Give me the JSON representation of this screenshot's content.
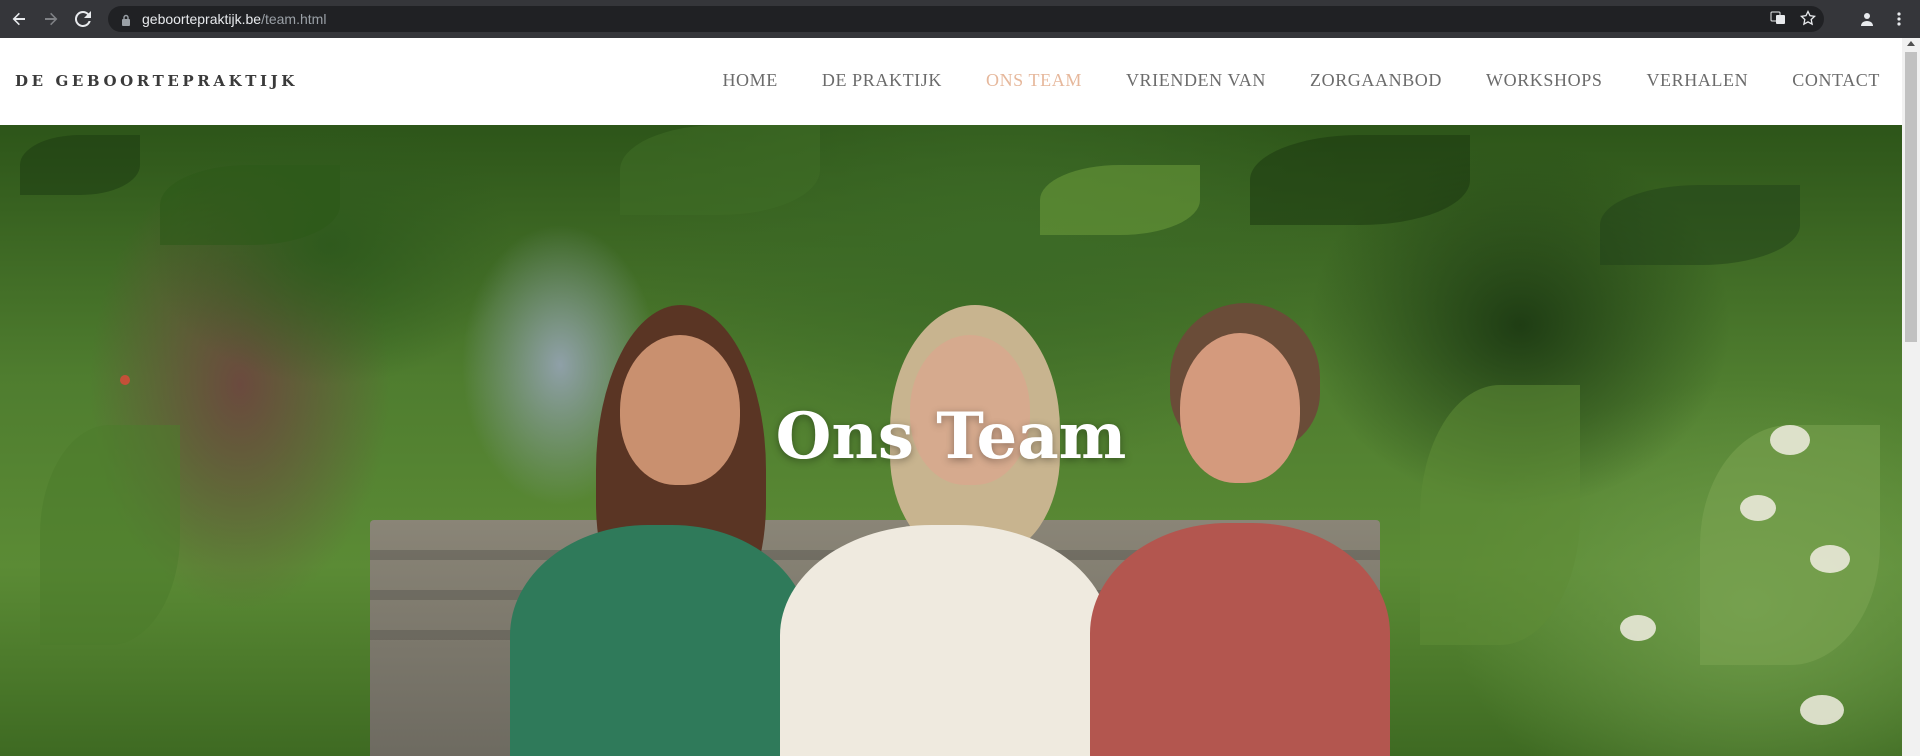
{
  "browser": {
    "url_domain": "geboortepraktijk.be",
    "url_path": "/team.html"
  },
  "site": {
    "logo": "DE GEBOORTEPRAKTIJK",
    "nav": [
      {
        "label": "HOME",
        "active": false
      },
      {
        "label": "DE PRAKTIJK",
        "active": false
      },
      {
        "label": "ONS TEAM",
        "active": true
      },
      {
        "label": "VRIENDEN VAN",
        "active": false
      },
      {
        "label": "ZORGAANBOD",
        "active": false
      },
      {
        "label": "WORKSHOPS",
        "active": false
      },
      {
        "label": "VERHALEN",
        "active": false
      },
      {
        "label": "CONTACT",
        "active": false
      }
    ],
    "accent_color": "#e6b89c"
  },
  "hero": {
    "title": "Ons Team"
  }
}
